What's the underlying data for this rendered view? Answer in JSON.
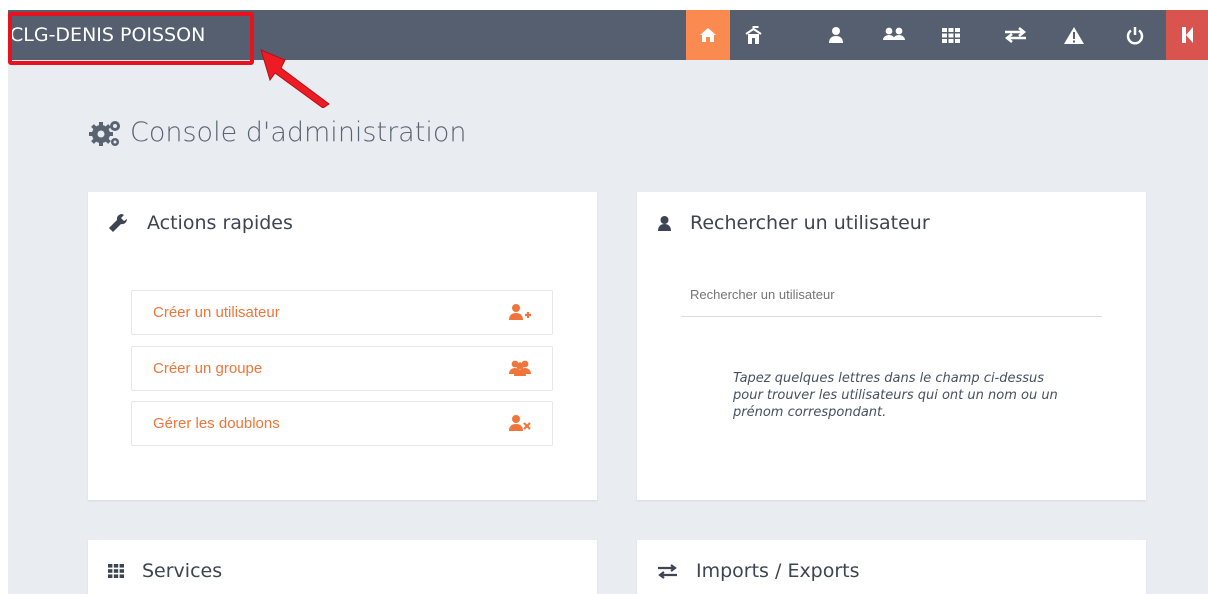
{
  "header": {
    "school": "CLG-DENIS POISSON",
    "nav": [
      "home-icon",
      "school-icon",
      "user-icon",
      "users-icon",
      "grid-icon",
      "exchange-icon",
      "warning-icon",
      "power-icon",
      "k-icon"
    ]
  },
  "page": {
    "title": "Console d'administration"
  },
  "quick": {
    "title": "Actions rapides",
    "actions": [
      {
        "label": "Créer un utilisateur",
        "icon": "user-plus-icon"
      },
      {
        "label": "Créer un groupe",
        "icon": "users-icon"
      },
      {
        "label": "Gérer les doublons",
        "icon": "user-remove-icon"
      }
    ]
  },
  "search": {
    "title": "Rechercher un utilisateur",
    "placeholder": "Rechercher un utilisateur",
    "hint": "Tapez quelques lettres dans le champ ci-dessus pour trouver les utilisateurs qui ont un nom ou un prénom correspondant."
  },
  "services": {
    "title": "Services"
  },
  "imports": {
    "title": "Imports / Exports"
  },
  "colors": {
    "topbar": "#555f6f",
    "accent": "#fa8a4f",
    "highlight": "#e8121e",
    "background": "#e9ecf1"
  }
}
